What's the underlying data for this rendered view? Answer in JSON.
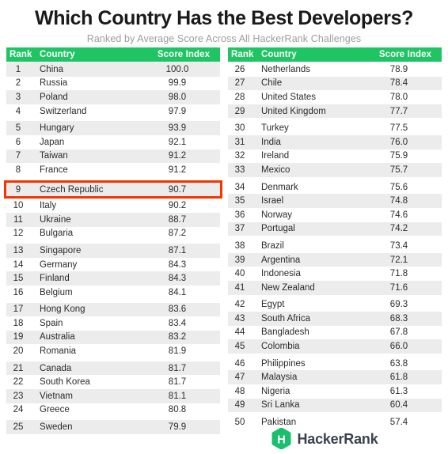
{
  "header": {
    "title": "Which Country Has the Best Developers?",
    "subtitle": "Ranked by Average Score Across All HackerRank Challenges"
  },
  "columns": {
    "rank": "Rank",
    "country": "Country",
    "score": "Score Index"
  },
  "colors": {
    "header_green": "#1fc463",
    "row_shade": "#ececec",
    "row_plain": "#ffffff",
    "highlight_red": "#f53500",
    "logo_green": "#19bf6c",
    "logo_text": "#39424e",
    "subtitle_gray": "#9d9d9d"
  },
  "footer": {
    "logo_icon": "hackerrank-hexagon-icon",
    "logo_letter": "H",
    "logo_text": "HackerRank"
  },
  "highlighted_rank": 9,
  "chart_data": {
    "type": "table",
    "title": "Which Country Has the Best Developers?",
    "subtitle": "Ranked by Average Score Across All HackerRank Challenges",
    "columns": [
      "Rank",
      "Country",
      "Score Index"
    ],
    "ylabel": "Score Index",
    "xlabel": "Country",
    "ylim": [
      50,
      100
    ],
    "highlighted_row": {
      "rank": 9,
      "country": "Czech Republic",
      "score": "90.7"
    },
    "rows": [
      {
        "rank": "1",
        "country": "China",
        "score": "100.0"
      },
      {
        "rank": "2",
        "country": "Russia",
        "score": "99.9"
      },
      {
        "rank": "3",
        "country": "Poland",
        "score": "98.0"
      },
      {
        "rank": "4",
        "country": "Switzerland",
        "score": "97.9"
      },
      {
        "rank": "5",
        "country": "Hungary",
        "score": "93.9"
      },
      {
        "rank": "6",
        "country": "Japan",
        "score": "92.1"
      },
      {
        "rank": "7",
        "country": "Taiwan",
        "score": "91.2"
      },
      {
        "rank": "8",
        "country": "France",
        "score": "91.2"
      },
      {
        "rank": "9",
        "country": "Czech Republic",
        "score": "90.7"
      },
      {
        "rank": "10",
        "country": "Italy",
        "score": "90.2"
      },
      {
        "rank": "11",
        "country": "Ukraine",
        "score": "88.7"
      },
      {
        "rank": "12",
        "country": "Bulgaria",
        "score": "87.2"
      },
      {
        "rank": "13",
        "country": "Singapore",
        "score": "87.1"
      },
      {
        "rank": "14",
        "country": "Germany",
        "score": "84.3"
      },
      {
        "rank": "15",
        "country": "Finland",
        "score": "84.3"
      },
      {
        "rank": "16",
        "country": "Belgium",
        "score": "84.1"
      },
      {
        "rank": "17",
        "country": "Hong Kong",
        "score": "83.6"
      },
      {
        "rank": "18",
        "country": "Spain",
        "score": "83.4"
      },
      {
        "rank": "19",
        "country": "Australia",
        "score": "83.2"
      },
      {
        "rank": "20",
        "country": "Romania",
        "score": "81.9"
      },
      {
        "rank": "21",
        "country": "Canada",
        "score": "81.7"
      },
      {
        "rank": "22",
        "country": "South Korea",
        "score": "81.7"
      },
      {
        "rank": "23",
        "country": "Vietnam",
        "score": "81.1"
      },
      {
        "rank": "24",
        "country": "Greece",
        "score": "80.8"
      },
      {
        "rank": "25",
        "country": "Sweden",
        "score": "79.9"
      },
      {
        "rank": "26",
        "country": "Netherlands",
        "score": "78.9"
      },
      {
        "rank": "27",
        "country": "Chile",
        "score": "78.4"
      },
      {
        "rank": "28",
        "country": "United States",
        "score": "78.0"
      },
      {
        "rank": "29",
        "country": "United Kingdom",
        "score": "77.7"
      },
      {
        "rank": "30",
        "country": "Turkey",
        "score": "77.5"
      },
      {
        "rank": "31",
        "country": "India",
        "score": "76.0"
      },
      {
        "rank": "32",
        "country": "Ireland",
        "score": "75.9"
      },
      {
        "rank": "33",
        "country": "Mexico",
        "score": "75.7"
      },
      {
        "rank": "34",
        "country": "Denmark",
        "score": "75.6"
      },
      {
        "rank": "35",
        "country": "Israel",
        "score": "74.8"
      },
      {
        "rank": "36",
        "country": "Norway",
        "score": "74.6"
      },
      {
        "rank": "37",
        "country": "Portugal",
        "score": "74.2"
      },
      {
        "rank": "38",
        "country": "Brazil",
        "score": "73.4"
      },
      {
        "rank": "39",
        "country": "Argentina",
        "score": "72.1"
      },
      {
        "rank": "40",
        "country": "Indonesia",
        "score": "71.8"
      },
      {
        "rank": "41",
        "country": "New Zealand",
        "score": "71.6"
      },
      {
        "rank": "42",
        "country": "Egypt",
        "score": "69.3"
      },
      {
        "rank": "43",
        "country": "South Africa",
        "score": "68.3"
      },
      {
        "rank": "44",
        "country": "Bangladesh",
        "score": "67.8"
      },
      {
        "rank": "45",
        "country": "Colombia",
        "score": "66.0"
      },
      {
        "rank": "46",
        "country": "Philippines",
        "score": "63.8"
      },
      {
        "rank": "47",
        "country": "Malaysia",
        "score": "61.8"
      },
      {
        "rank": "48",
        "country": "Nigeria",
        "score": "61.3"
      },
      {
        "rank": "49",
        "country": "Sri Lanka",
        "score": "60.4"
      },
      {
        "rank": "50",
        "country": "Pakistan",
        "score": "57.4"
      }
    ]
  }
}
